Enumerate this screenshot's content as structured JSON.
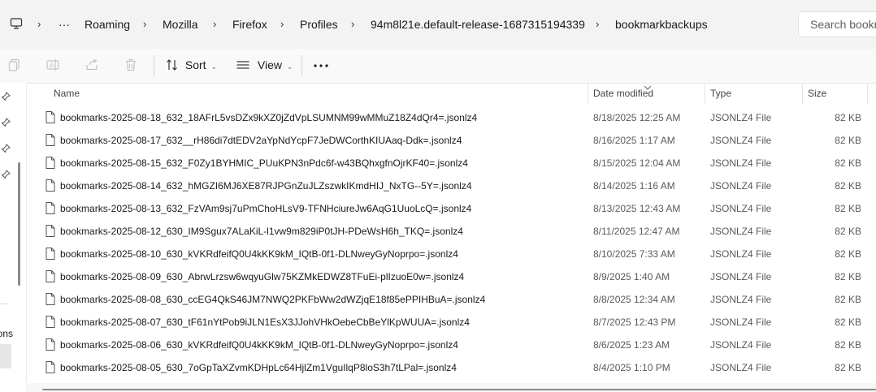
{
  "address_bar": {
    "breadcrumbs": [
      "Roaming",
      "Mozilla",
      "Firefox",
      "Profiles",
      "94m8l21e.default-release-1687315194339",
      "bookmarkbackups"
    ],
    "more_label": "···",
    "search_placeholder": "Search bookm"
  },
  "toolbar": {
    "sort_label": "Sort",
    "view_label": "View",
    "more_label": "···"
  },
  "nav_pane": {
    "partial_label": "ons"
  },
  "columns": {
    "name": "Name",
    "date_modified": "Date modified",
    "type": "Type",
    "size": "Size"
  },
  "files": [
    {
      "name": "bookmarks-2025-08-18_632_18AFrL5vsDZx9kXZ0jZdVpLSUMNM99wMMuZ18Z4dQr4=.jsonlz4",
      "date": "8/18/2025 12:25 AM",
      "type": "JSONLZ4 File",
      "size": "82 KB"
    },
    {
      "name": "bookmarks-2025-08-17_632__rH86di7dtEDV2aYpNdYcpF7JeDWCorthKIUAaq-Ddk=.jsonlz4",
      "date": "8/16/2025 1:17 AM",
      "type": "JSONLZ4 File",
      "size": "82 KB"
    },
    {
      "name": "bookmarks-2025-08-15_632_F0Zy1BYHMIC_PUuKPN3nPdc6f-w43BQhxgfnOjrKF40=.jsonlz4",
      "date": "8/15/2025 12:04 AM",
      "type": "JSONLZ4 File",
      "size": "82 KB"
    },
    {
      "name": "bookmarks-2025-08-14_632_hMGZI6MJ6XE87RJPGnZuJLZszwkIKmdHIJ_NxTG--5Y=.jsonlz4",
      "date": "8/14/2025 1:16 AM",
      "type": "JSONLZ4 File",
      "size": "82 KB"
    },
    {
      "name": "bookmarks-2025-08-13_632_FzVAm9sj7uPmChoHLsV9-TFNHciureJw6AqG1UuoLcQ=.jsonlz4",
      "date": "8/13/2025 12:43 AM",
      "type": "JSONLZ4 File",
      "size": "82 KB"
    },
    {
      "name": "bookmarks-2025-08-12_630_IM9Sgux7ALaKiL-l1vw9m829iP0tJH-PDeWsH6h_TKQ=.jsonlz4",
      "date": "8/11/2025 12:47 AM",
      "type": "JSONLZ4 File",
      "size": "82 KB"
    },
    {
      "name": "bookmarks-2025-08-10_630_kVKRdfeifQ0U4kKK9kM_IQtB-0f1-DLNweyGyNoprpo=.jsonlz4",
      "date": "8/10/2025 7:33 AM",
      "type": "JSONLZ4 File",
      "size": "82 KB"
    },
    {
      "name": "bookmarks-2025-08-09_630_AbrwLrzsw6wqyuGlw75KZMkEDWZ8TFuEi-plIzuoE0w=.jsonlz4",
      "date": "8/9/2025 1:40 AM",
      "type": "JSONLZ4 File",
      "size": "82 KB"
    },
    {
      "name": "bookmarks-2025-08-08_630_ccEG4QkS46JM7NWQ2PKFbWw2dWZjqE18f85ePPIHBuA=.jsonlz4",
      "date": "8/8/2025 12:34 AM",
      "type": "JSONLZ4 File",
      "size": "82 KB"
    },
    {
      "name": "bookmarks-2025-08-07_630_tF61nYtPob9iJLN1EsX3JJohVHkOebeCbBeYlKpWUUA=.jsonlz4",
      "date": "8/7/2025 12:43 PM",
      "type": "JSONLZ4 File",
      "size": "82 KB"
    },
    {
      "name": "bookmarks-2025-08-06_630_kVKRdfeifQ0U4kKK9kM_IQtB-0f1-DLNweyGyNoprpo=.jsonlz4",
      "date": "8/6/2025 1:23 AM",
      "type": "JSONLZ4 File",
      "size": "82 KB"
    },
    {
      "name": "bookmarks-2025-08-05_630_7oGpTaXZvmKDHpLc64HjlZm1VguIlqP8loS3h7tLPal=.jsonlz4",
      "date": "8/4/2025 1:10 PM",
      "type": "JSONLZ4 File",
      "size": "82 KB"
    }
  ],
  "icons": {
    "path_icon": "monitor-icon",
    "file_icon": "document-icon",
    "copy_icon": "copy-icon",
    "rename_icon": "rename-icon",
    "share_icon": "share-icon",
    "delete_icon": "trash-icon",
    "sort_icon": "sort-icon",
    "view_icon": "view-list-icon",
    "pin_icon": "pin-icon"
  }
}
